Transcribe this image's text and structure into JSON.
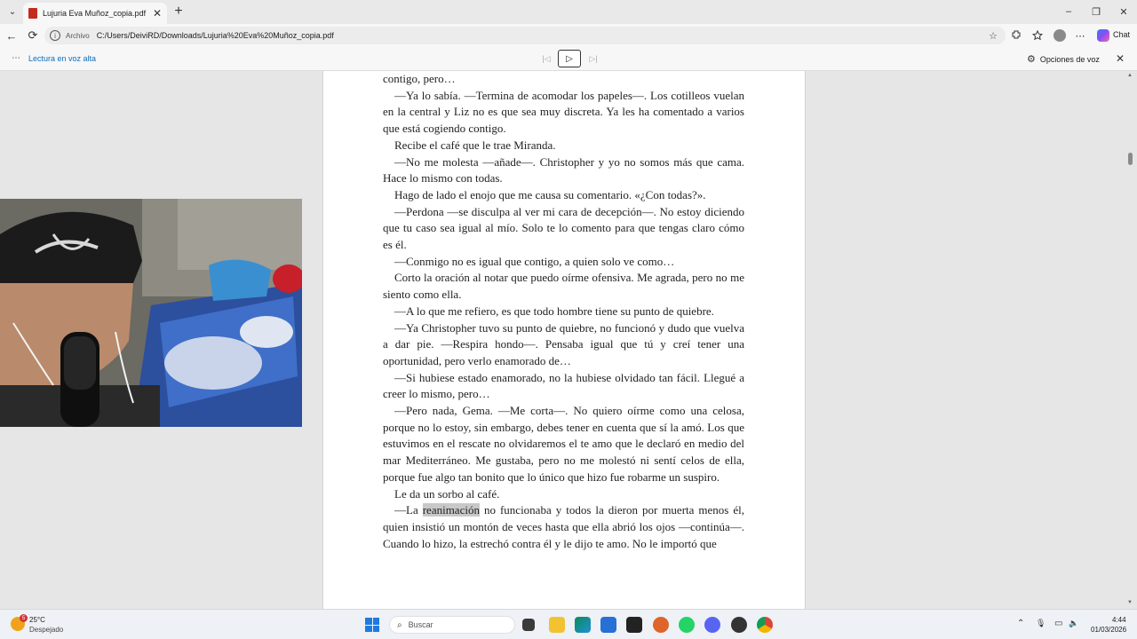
{
  "browser": {
    "tab_title": "Lujuria Eva Muñoz_copia.pdf",
    "tab_close": "✕",
    "new_tab": "+",
    "tab_list": "⌄",
    "window": {
      "minimize": "–",
      "restore": "❐",
      "close": "✕"
    },
    "back": "←",
    "reload": "⟳",
    "info_icon": "i",
    "address_label": "Archivo",
    "url": "C:/Users/DeiviRD/Downloads/Lujuria%20Eva%20Muñoz_copia.pdf",
    "favorite_icon": "☆",
    "chat_label": "Chat"
  },
  "read_aloud": {
    "menu_dots": "⋯",
    "label": "Lectura en voz alta",
    "prev": "|◁",
    "play": "▷",
    "next": "▷|",
    "voice_options": "Opciones de voz",
    "close": "✕"
  },
  "document": {
    "paragraphs": [
      {
        "indent": false,
        "text": "contigo, pero…"
      },
      {
        "indent": true,
        "text": "—Ya lo sabía. —Termina de acomodar los papeles—. Los cotilleos vuelan en la central y Liz no es que sea muy discreta. Ya les ha comentado a varios que está cogiendo contigo."
      },
      {
        "indent": true,
        "text": "Recibe el café que le trae Miranda."
      },
      {
        "indent": true,
        "text": "—No me molesta —añade—. Christopher y yo no somos más que cama. Hace lo mismo con todas."
      },
      {
        "indent": true,
        "text": "Hago de lado el enojo que me causa su comentario. «¿Con todas?»."
      },
      {
        "indent": true,
        "text": "—Perdona —se disculpa al ver mi cara de decepción—. No estoy diciendo que tu caso sea igual al mío. Solo te lo comento para que tengas claro cómo es él."
      },
      {
        "indent": true,
        "text": "—Conmigo no es igual que contigo, a quien solo ve como…"
      },
      {
        "indent": true,
        "text": "Corto la oración al notar que puedo oírme ofensiva. Me agrada, pero no me siento como ella."
      },
      {
        "indent": true,
        "text": "—A lo que me refiero, es que todo hombre tiene su punto de quiebre."
      },
      {
        "indent": true,
        "text": "—Ya Christopher tuvo su punto de quiebre, no funcionó y dudo que vuelva a dar pie. —Respira hondo—. Pensaba igual que tú y creí tener una oportunidad, pero verlo enamorado de…"
      },
      {
        "indent": true,
        "text": "—Si hubiese estado enamorado, no la hubiese olvidado tan fácil. Llegué a creer lo mismo, pero…"
      },
      {
        "indent": true,
        "text": "—Pero nada, Gema. —Me corta—. No quiero oírme como una celosa, porque no lo estoy, sin embargo, debes tener en cuenta que sí la amó. Los que estuvimos en el rescate no olvidaremos el te amo que le declaró en medio del mar Mediterráneo. Me gustaba, pero no me molestó ni sentí celos de ella, porque fue algo tan bonito que lo único que hizo fue robarme un suspiro."
      },
      {
        "indent": true,
        "text": "Le da un sorbo al café."
      }
    ],
    "last_para": {
      "pre": "—La ",
      "highlight": "reanimación",
      "post": " no funcionaba y todos la dieron por muerta menos él, quien insistió un montón de veces hasta que ella abrió los ojos —continúa—. Cuando lo hizo, la estrechó contra él y le dijo te amo. No le importó que"
    }
  },
  "taskbar": {
    "weather_temp": "25°C",
    "weather_cond": "Despejado",
    "weather_badge": "5",
    "search_icon": "⌕",
    "search_placeholder": "Buscar",
    "tray_up": "⌃",
    "tray_mic": "🎙",
    "tray_net": "▭",
    "tray_vol": "🔈",
    "time": "4:44",
    "date": "01/03/2026"
  }
}
